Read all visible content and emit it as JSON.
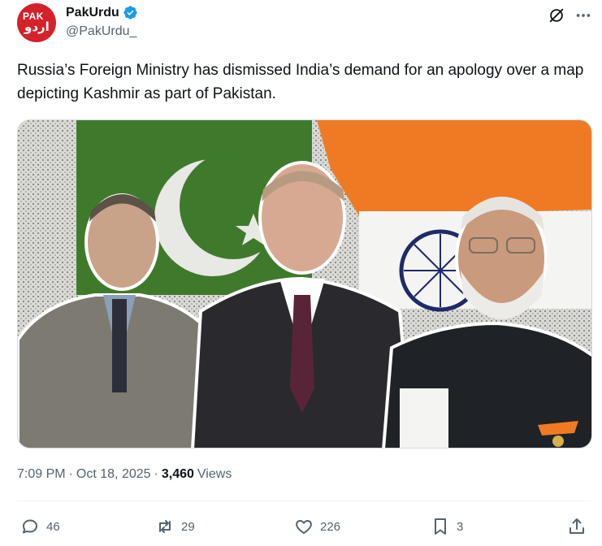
{
  "author": {
    "display_name": "PakUrdu",
    "handle": "@PakUrdu_",
    "avatar_text_top": "PAK",
    "avatar_text_bottom": "اردو"
  },
  "tweet": {
    "text": "Russia’s Foreign Ministry has dismissed India’s demand for an apology over a map depicting Kashmir as part of Pakistan."
  },
  "meta": {
    "time": "7:09 PM",
    "separator1": "·",
    "date": "Oct 18, 2025",
    "separator2": "·",
    "views_count": "3,460",
    "views_label": "Views"
  },
  "actions": {
    "replies": "46",
    "reposts": "29",
    "likes": "226",
    "bookmarks": "3"
  },
  "colors": {
    "accent": "#1d9bf0",
    "text_primary": "#0f1419",
    "text_secondary": "#536471",
    "brand_red": "#d4212a"
  },
  "icons": [
    "verified-badge-icon",
    "grok-icon",
    "more-icon",
    "reply-icon",
    "repost-icon",
    "like-icon",
    "bookmark-icon",
    "share-icon"
  ]
}
